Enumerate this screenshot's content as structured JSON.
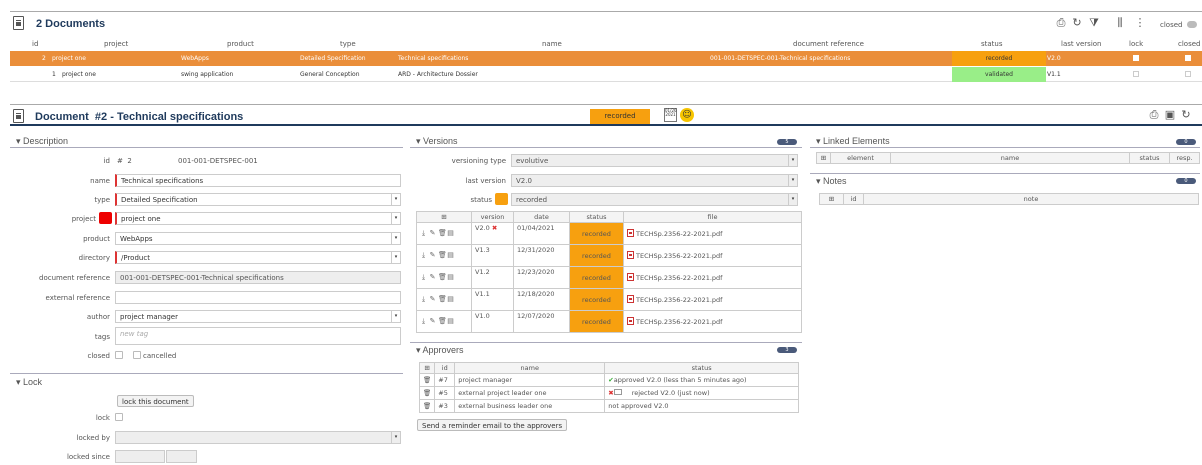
{
  "list": {
    "title": "2 Documents",
    "closed_label": "closed",
    "columns": [
      "id",
      "project",
      "product",
      "type",
      "document reference",
      "status",
      "last version",
      "lock",
      "closed"
    ],
    "name_col": "name",
    "rows": [
      {
        "id": "2",
        "project": "project one",
        "product": "WebApps",
        "type": "Detailed Specification",
        "name": "Technical specifications",
        "ref": "001-001-DETSPEC-001-Technical specifications",
        "status": "recorded",
        "version": "V2.0"
      },
      {
        "id": "1",
        "project": "project one",
        "product": "swing application",
        "type": "General Conception",
        "name": "ARD - Architecture Dossier",
        "ref": "",
        "status": "validated",
        "version": "V1.1"
      }
    ]
  },
  "header": {
    "prefix": "Document",
    "number": "#2",
    "sep": " - ",
    "name": "Technical specifications",
    "status": "recorded",
    "calendar_text": "01/26\n2021"
  },
  "description": {
    "section": "Description",
    "id_label": "id",
    "id_hash": "#",
    "id_value": "2",
    "id_ref": "001-001-DETSPEC-001",
    "name_label": "name",
    "name_value": "Technical specifications",
    "type_label": "type",
    "type_value": "Detailed Specification",
    "project_label": "project",
    "project_value": "project one",
    "product_label": "product",
    "product_value": "WebApps",
    "directory_label": "directory",
    "directory_value": "/Product",
    "docref_label": "document reference",
    "docref_value": "001-001-DETSPEC-001-Technical specifications",
    "extref_label": "external reference",
    "extref_value": "",
    "author_label": "author",
    "author_value": "project manager",
    "tags_label": "tags",
    "tags_placeholder": "new tag",
    "closed_label": "closed",
    "cancelled_label": "cancelled"
  },
  "lock": {
    "section": "Lock",
    "button": "lock this document",
    "lock_label": "lock",
    "locked_by_label": "locked by",
    "locked_since_label": "locked since"
  },
  "versions": {
    "section": "Versions",
    "count": "5",
    "vtype_label": "versioning type",
    "vtype_value": "evolutive",
    "last_label": "last version",
    "last_value": "V2.0",
    "status_label": "status",
    "status_value": "recorded",
    "cols": [
      "version",
      "date",
      "status",
      "file"
    ],
    "rows": [
      {
        "version": "V2.0",
        "date": "01/04/2021",
        "status": "recorded",
        "file": "TECHSp.2356-22-2021.pdf"
      },
      {
        "version": "V1.3",
        "date": "12/31/2020",
        "status": "recorded",
        "file": "TECHSp.2356-22-2021.pdf"
      },
      {
        "version": "V1.2",
        "date": "12/23/2020",
        "status": "recorded",
        "file": "TECHSp.2356-22-2021.pdf"
      },
      {
        "version": "V1.1",
        "date": "12/18/2020",
        "status": "recorded",
        "file": "TECHSp.2356-22-2021.pdf"
      },
      {
        "version": "V1.0",
        "date": "12/07/2020",
        "status": "recorded",
        "file": "TECHSp.2356-22-2021.pdf"
      }
    ]
  },
  "approvers": {
    "section": "Approvers",
    "count": "3",
    "cols": [
      "id",
      "name",
      "status"
    ],
    "rows": [
      {
        "id": "#7",
        "name": "project manager",
        "status": "approved V2.0 (less than 5 minutes ago)"
      },
      {
        "id": "#5",
        "name": "external project leader one",
        "status": "rejected V2.0 (just now)"
      },
      {
        "id": "#3",
        "name": "external business leader one",
        "status": "not approved V2.0"
      }
    ],
    "reminder": "Send a reminder email to the approvers"
  },
  "linked": {
    "section": "Linked Elements",
    "count": "0",
    "cols": [
      "element",
      "name",
      "status",
      "resp."
    ]
  },
  "notes": {
    "section": "Notes",
    "count": "0",
    "cols": [
      "id",
      "note"
    ]
  },
  "colors": {
    "accent": "#ea8e3a",
    "recorded": "#f7a00f",
    "validated": "#99ee88",
    "title": "#1f3a5c"
  }
}
